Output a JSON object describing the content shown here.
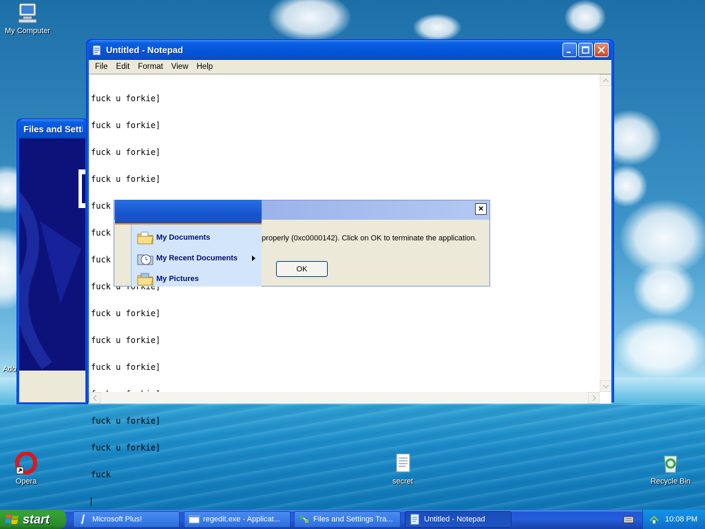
{
  "desktop": {
    "icons": [
      {
        "label": "My Computer",
        "icon": "my-computer-icon"
      },
      {
        "label": "Ado",
        "icon": "truncated-icon"
      },
      {
        "label": "Opera",
        "icon": "opera-icon"
      },
      {
        "label": "secret",
        "icon": "text-document-icon"
      },
      {
        "label": "Recycle Bin",
        "icon": "recycle-bin-icon"
      }
    ]
  },
  "notepad": {
    "title": "Untitled - Notepad",
    "menu": [
      "File",
      "Edit",
      "Format",
      "View",
      "Help"
    ],
    "lines": [
      "fuck u forkie]",
      "fuck u forkie]",
      "fuck u forkie]",
      "fuck u forkie]",
      "fuck u forkie]",
      "fuck u forkie]",
      "fuck u forkie]",
      "fuck u forkie]",
      "fuck u forkie]",
      "fuck u forkie]",
      "fuck u forkie]",
      "fuck u forkie]",
      "fuck u forkie]",
      "fuck u forkie]",
      "fuck"
    ]
  },
  "files_window": {
    "title": "Files and Settin"
  },
  "error_dialog": {
    "close_glyph": "×",
    "message": "e properly (0xc0000142). Click on OK to terminate the application.",
    "ok_label": "OK"
  },
  "start_menu": {
    "items": [
      {
        "label": "My Documents",
        "icon": "folder-documents-icon",
        "submenu": false
      },
      {
        "label": "My Recent Documents",
        "icon": "recent-documents-icon",
        "submenu": true
      },
      {
        "label": "My Pictures",
        "icon": "folder-pictures-icon",
        "submenu": false
      }
    ]
  },
  "taskbar": {
    "start_label": "start",
    "tasks": [
      {
        "label": "Microsoft Plus!",
        "icon": "plus-icon"
      },
      {
        "label": "regedit.exe - Applicat...",
        "icon": "app-window-icon"
      },
      {
        "label": "Files and Settings Tra...",
        "icon": "transfer-wizard-icon"
      },
      {
        "label": "Untitled - Notepad",
        "icon": "notepad-icon"
      }
    ],
    "clock": "10:08 PM"
  }
}
